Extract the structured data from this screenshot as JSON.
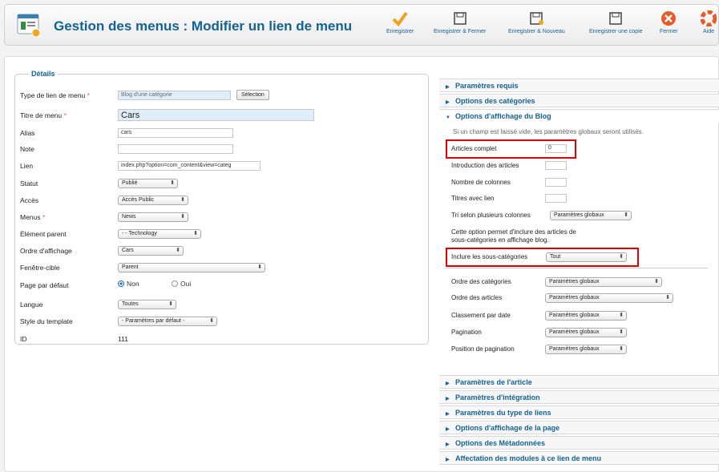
{
  "header": {
    "title": "Gestion des menus : Modifier un lien de menu",
    "toolbar": [
      {
        "label": "Enregistrer",
        "icon": "checkmark-icon"
      },
      {
        "label": "Enregistrer & Fermer",
        "icon": "save-close-icon"
      },
      {
        "label": "Enregistrer & Nouveau",
        "icon": "save-new-icon"
      },
      {
        "label": "Enregistrer une copie",
        "icon": "save-copy-icon"
      },
      {
        "label": "Fermer",
        "icon": "close-icon"
      },
      {
        "label": "Aide",
        "icon": "help-icon"
      }
    ]
  },
  "details": {
    "legend": "Détails",
    "req_star": "*",
    "fields": {
      "type": {
        "label": "Type de lien de menu",
        "value": "Blog d'une catégorie",
        "button": "Sélection"
      },
      "title": {
        "label": "Titre de menu",
        "value": "Cars"
      },
      "alias": {
        "label": "Alias",
        "value": "cars"
      },
      "note": {
        "label": "Note",
        "value": ""
      },
      "link": {
        "label": "Lien",
        "value": "index.php?option=com_content&view=categ"
      },
      "status": {
        "label": "Statut",
        "value": "Publié"
      },
      "access": {
        "label": "Accès",
        "value": "Accès Public"
      },
      "menus": {
        "label": "Menus",
        "value": "News"
      },
      "parent": {
        "label": "Élément parent",
        "value": "- - Technology"
      },
      "order": {
        "label": "Ordre d'affichage",
        "value": "Cars"
      },
      "target": {
        "label": "Fenêtre-cible",
        "value": "Parent"
      },
      "home": {
        "label": "Page par défaut",
        "option_no": "Non",
        "option_yes": "Oui"
      },
      "language": {
        "label": "Langue",
        "value": "Toutes"
      },
      "template": {
        "label": "Style du template",
        "value": "- Paramètres par défaut -"
      },
      "id": {
        "label": "ID",
        "value": "111"
      }
    }
  },
  "panels": {
    "required": "Paramètres requis",
    "category_options": "Options des catégories",
    "blog_options": "Options d'affichage du Blog",
    "blog_note": "Si un champ est laissé vide, les paramètres globaux seront utilisés.",
    "blog_fields": {
      "leading": {
        "label": "Articles complet",
        "value": "0"
      },
      "intro": {
        "label": "Introduction des articles",
        "value": ""
      },
      "columns": {
        "label": "Nombre de colonnes",
        "value": ""
      },
      "links": {
        "label": "Titres avec lien",
        "value": ""
      },
      "multi_sort": {
        "label": "Tri selon plusieurs colonnes",
        "value": "Paramètres globaux"
      },
      "subcat_note_1": "Cette option permet d'inclure des articles de",
      "subcat_note_2": "sous-catégories en affichage blog.",
      "subcats": {
        "label": "Inclure les sous-catégories",
        "value": "Tout"
      },
      "cat_order": {
        "label": "Ordre des catégories",
        "value": "Paramètres globaux"
      },
      "article_order": {
        "label": "Ordre des articles",
        "value": "Paramètres globaux"
      },
      "date_sort": {
        "label": "Classement par date",
        "value": "Paramètres globaux"
      },
      "pagination": {
        "label": "Pagination",
        "value": "Paramètres globaux"
      },
      "pagination_pos": {
        "label": "Position de pagination",
        "value": "Paramètres globaux"
      }
    },
    "article_params": "Paramètres de l'article",
    "integration": "Paramètres d'intégration",
    "link_type": "Paramètres du type de liens",
    "page_display": "Options d'affichage de la page",
    "metadata": "Options des Métadonnées",
    "modules": "Affectation des modules à ce lien de menu"
  }
}
